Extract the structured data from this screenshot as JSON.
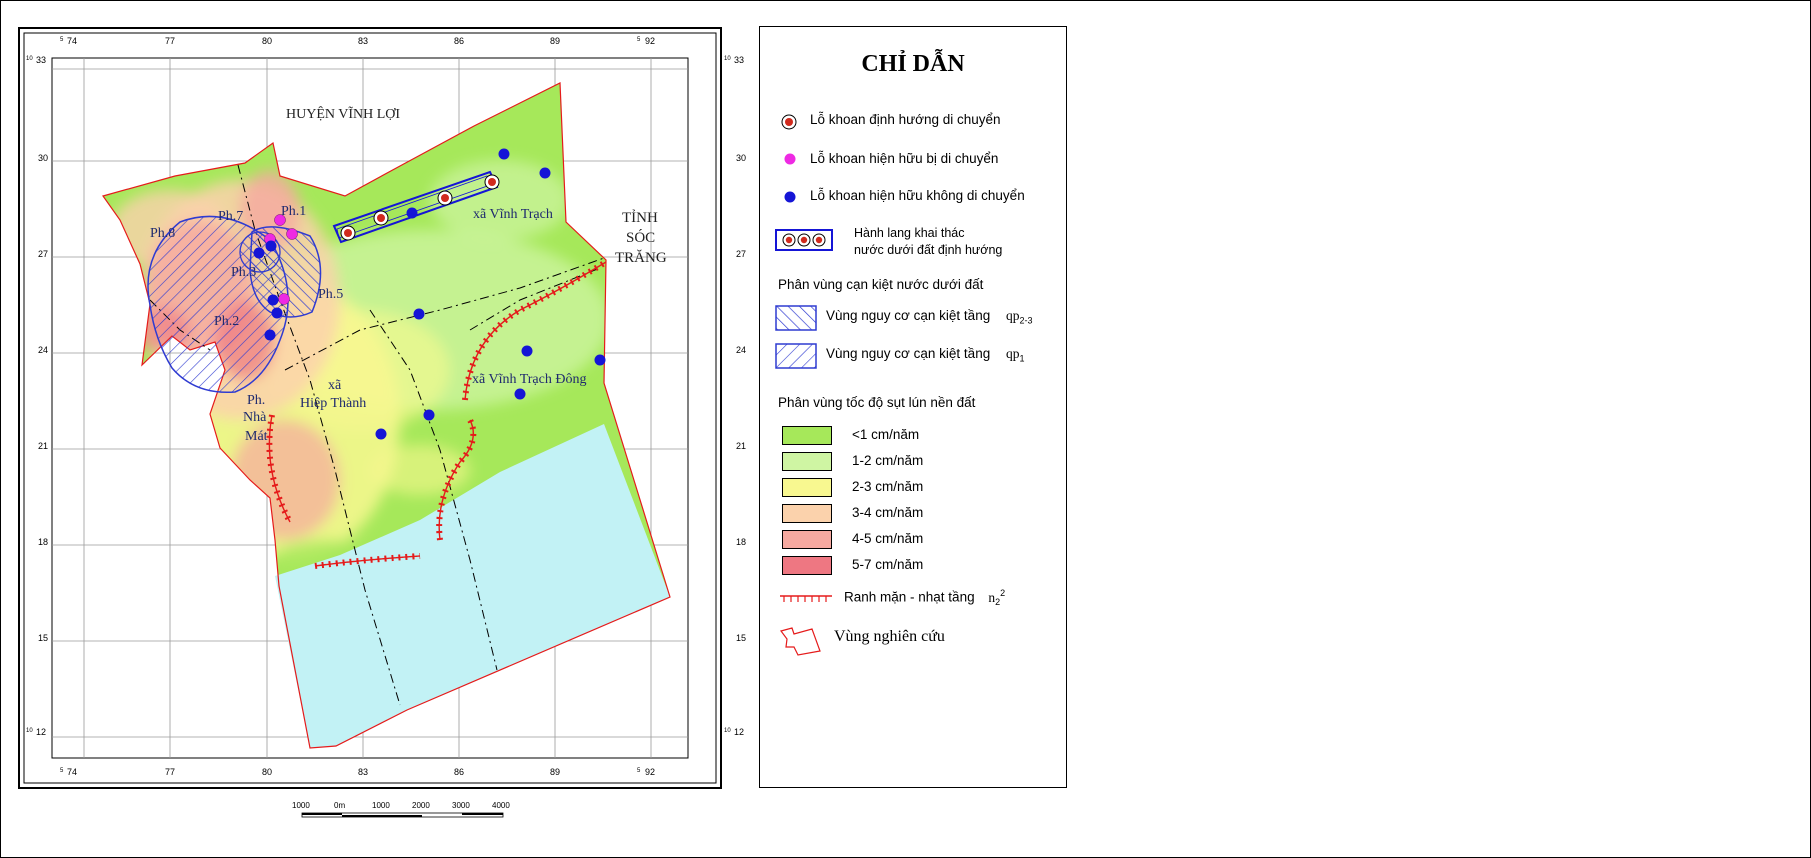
{
  "colors": {
    "sub_lt1": "#a6e85a",
    "sub_1_2": "#cff5a3",
    "sub_2_3": "#f8f890",
    "sub_3_4": "#fbd2ac",
    "sub_4_5": "#f6a9a0",
    "sub_5_7": "#ee7782",
    "sea": "#c2f2f5",
    "well_blue": "#1515d6",
    "well_magenta": "#ee2ae3",
    "boundary_red": "#e51b1b",
    "hatch_blue": "#2f3bd1"
  },
  "map": {
    "grid_top_labels": [
      {
        "sup": "5",
        "text": "74"
      },
      {
        "sup": "",
        "text": "77"
      },
      {
        "sup": "",
        "text": "80"
      },
      {
        "sup": "",
        "text": "83"
      },
      {
        "sup": "",
        "text": "86"
      },
      {
        "sup": "",
        "text": "89"
      },
      {
        "sup": "5",
        "text": "92"
      }
    ],
    "grid_side_labels": [
      {
        "sup": "10",
        "text": "33"
      },
      {
        "sup": "",
        "text": "30"
      },
      {
        "sup": "",
        "text": "27"
      },
      {
        "sup": "",
        "text": "24"
      },
      {
        "sup": "",
        "text": "21"
      },
      {
        "sup": "",
        "text": "18"
      },
      {
        "sup": "",
        "text": "15"
      },
      {
        "sup": "10",
        "text": "12"
      }
    ],
    "place_labels": {
      "huyen_vinh_loi": "HUYỆN VĨNH LỢI",
      "tinh": "TỈNH",
      "soc": "SÓC",
      "trang": "TRĂNG",
      "xa_vinh_trach": "xã Vĩnh Trạch",
      "xa_vinh_trach_dong": "xã Vĩnh Trạch Đông",
      "xa": "xã",
      "hiep_thanh": "Hiệp Thành",
      "ph_nha": "Ph.",
      "nha": "Nhà",
      "mat": "Mát",
      "ph8": "Ph.8",
      "ph7": "Ph.7",
      "ph1": "Ph.1",
      "ph3": "Ph.3",
      "ph2": "Ph.2",
      "ph5": "Ph.5"
    },
    "scale_bar": {
      "labels": [
        "1000",
        "0m",
        "1000",
        "2000",
        "3000",
        "4000"
      ]
    }
  },
  "legend": {
    "title": "CHỈ DẪN",
    "well_relocate": "Lỗ khoan định hướng di chuyển",
    "well_existing_moved": "Lỗ khoan hiện hữu bị di chuyển",
    "well_existing_kept": "Lỗ khoan hiện hữu không di chuyển",
    "corridor_line1": "Hành lang khai thác",
    "corridor_line2": "nước dưới đất định hướng",
    "depletion_heading": "Phân vùng cạn kiệt nước dưới đất",
    "depletion_qp23_label": "Vùng nguy cơ cạn kiệt tầng",
    "depletion_qp23_code": "qp",
    "depletion_qp23_sub": "2-3",
    "depletion_qp1_label": "Vùng nguy cơ cạn kiệt tầng",
    "depletion_qp1_code": "qp",
    "depletion_qp1_sub": "1",
    "subsidence_heading": "Phân vùng tốc độ sụt lún nền đất",
    "subsidence_classes": [
      "<1 cm/năm",
      "1-2 cm/năm",
      "2-3 cm/năm",
      "3-4 cm/năm",
      "4-5 cm/năm",
      "5-7 cm/năm"
    ],
    "salinity_label": "Ranh mặn - nhạt tầng",
    "salinity_code": "n",
    "salinity_sub": "2",
    "salinity_sup": "2",
    "study_area": "Vùng nghiên cứu"
  }
}
